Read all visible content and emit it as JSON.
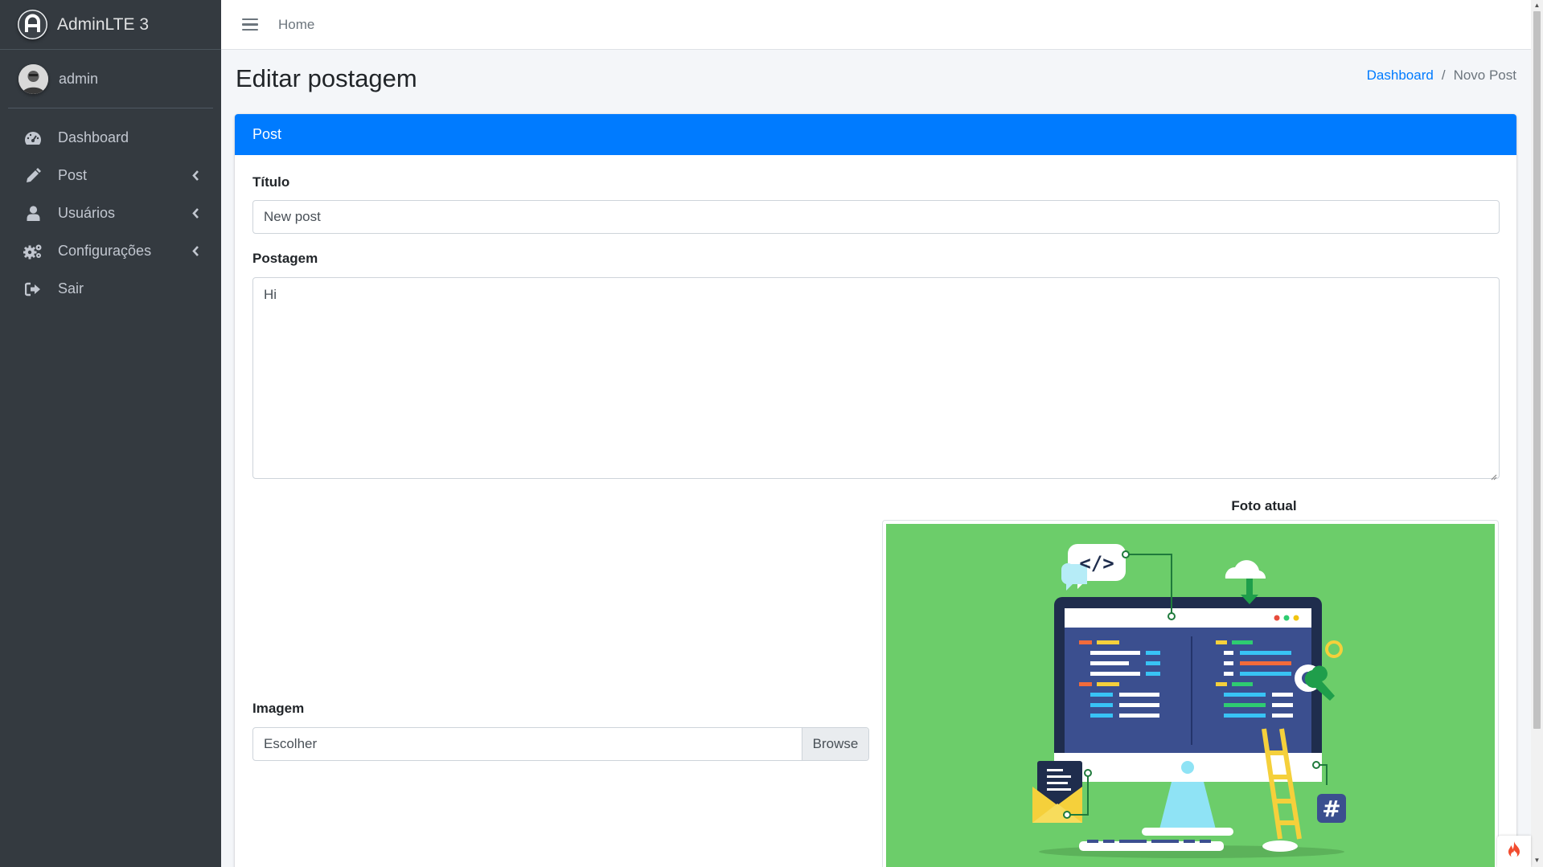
{
  "brand": {
    "name": "AdminLTE 3"
  },
  "user": {
    "name": "admin"
  },
  "sidebar": {
    "items": [
      {
        "label": "Dashboard",
        "icon": "tachometer-icon",
        "has_children": false
      },
      {
        "label": "Post",
        "icon": "pencil-icon",
        "has_children": true
      },
      {
        "label": "Usuários",
        "icon": "user-icon",
        "has_children": true
      },
      {
        "label": "Configurações",
        "icon": "cogs-icon",
        "has_children": true
      },
      {
        "label": "Sair",
        "icon": "sign-out-icon",
        "has_children": false
      }
    ]
  },
  "topbar": {
    "home_link": "Home"
  },
  "page": {
    "title": "Editar postagem",
    "breadcrumb": {
      "link": "Dashboard",
      "separator": "/",
      "active": "Novo Post"
    }
  },
  "card": {
    "header": "Post",
    "titulo_label": "Título",
    "titulo_value": "New post",
    "postagem_label": "Postagem",
    "postagem_value": "Hi",
    "imagem_label": "Imagem",
    "file_placeholder": "Escolher",
    "browse_label": "Browse",
    "foto_label": "Foto atual",
    "image_code_label": "</>"
  },
  "colors": {
    "sidebar_bg": "#343a40",
    "primary": "#007bff",
    "content_bg": "#f4f6f9",
    "image_bg": "#6ccd6a"
  }
}
